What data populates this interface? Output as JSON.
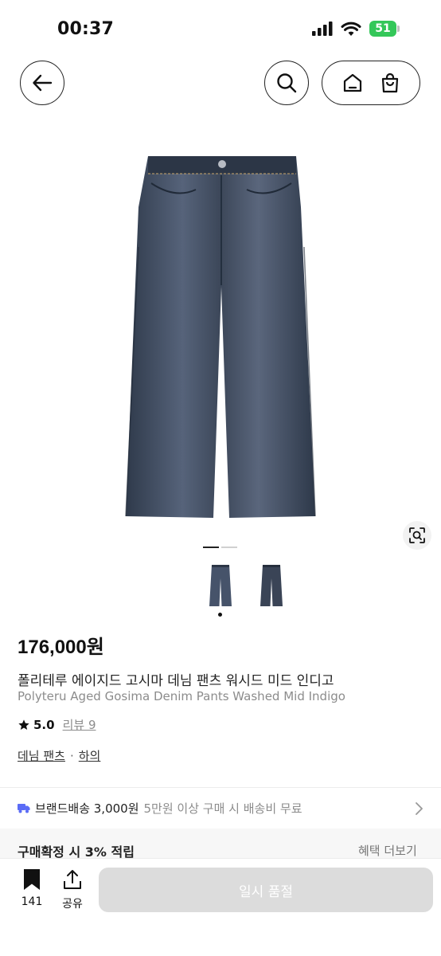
{
  "status_bar": {
    "time": "00:37",
    "battery": "51"
  },
  "header": {
    "back_icon": "arrow-left-icon",
    "search_icon": "search-icon",
    "home_icon": "home-icon",
    "bag_icon": "shopping-bag-icon"
  },
  "gallery": {
    "image_count": 2,
    "active_index": 0,
    "lens_icon": "visual-search-icon"
  },
  "product": {
    "price": "176,000원",
    "name_kr": "폴리테루 에이지드 고시마 데님 팬츠 워시드 미드 인디고",
    "name_en": "Polyteru Aged Gosima Denim Pants Washed Mid Indigo",
    "rating": "5.0",
    "review_label": "리뷰 9",
    "category": "데님 팬츠",
    "category_parent": "하의"
  },
  "shipping": {
    "label": "브랜드배송 3,000원",
    "sub": "5만원 이상 구매 시 배송비 무료",
    "icon": "truck-icon"
  },
  "benefit": {
    "label": "구매확정 시 3% 적립",
    "link": "혜택 더보기"
  },
  "bottom_bar": {
    "bookmark_count": "141",
    "share_label": "공유",
    "cta_label": "일시 품절"
  },
  "colors": {
    "battery": "#34c759",
    "shipping_icon": "#5b6cf6",
    "cta_disabled": "#dcdcdc",
    "denim": "#3d4a5c"
  }
}
